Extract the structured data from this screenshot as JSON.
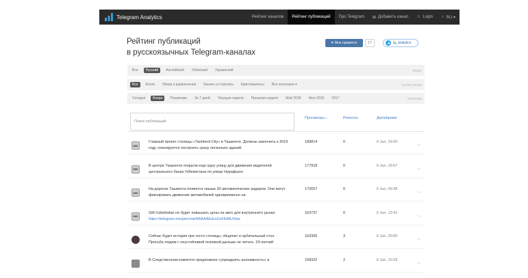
{
  "navbar": {
    "brand": "Telegram Analytics",
    "links": [
      {
        "label": "Рейтинг каналов",
        "icon": "",
        "active": false
      },
      {
        "label": "Рейтинг публикаций",
        "icon": "",
        "active": true
      },
      {
        "label": "Про Telegram",
        "icon": "",
        "active": false
      },
      {
        "label": "Добавить канал",
        "icon": "plus-square-icon",
        "active": false
      },
      {
        "label": "Login",
        "icon": "user-icon",
        "active": false
      },
      {
        "label": "RU ▾",
        "icon": "globe-icon",
        "active": false
      }
    ]
  },
  "header": {
    "title_line1": "Рейтинг публикаций",
    "title_line2": "в русскоязычных Telegram-каналах",
    "like_label": "Мне нравится",
    "like_count": "17",
    "tg_label": "tg_analytics"
  },
  "filters": {
    "language": {
      "items": [
        "Все",
        "Русский",
        "Английский",
        "Узбекский",
        "Украинский"
      ],
      "active_index": 1,
      "label": "ЯЗЫК"
    },
    "category": {
      "items": [
        "Все",
        "Блоги",
        "Юмор и развлечения",
        "Бизнес и стартапы",
        "Криптовалюты",
        "Все категории"
      ],
      "active_index": 0,
      "dropdown_index": 5,
      "label": "КАТЕГОРИИ"
    },
    "period": {
      "items": [
        "Сегодня",
        "Вчера",
        "Позавчера",
        "За 7 дней",
        "Текущая неделя",
        "Прошлая неделя",
        "Май 2018",
        "Июн 2018",
        "2017"
      ],
      "active_index": 1,
      "label": "ПЕРИОД"
    }
  },
  "search": {
    "placeholder": "Поиск публикаций"
  },
  "table": {
    "columns": {
      "views": "Просмотры ↓",
      "reposts": "Репосты",
      "date": "Дата/время"
    },
    "rows": [
      {
        "avatar": "MIX",
        "style": "av-mix",
        "text": "Главный проект столицы «Tashkent City» в Ташкенте. Должны закончить к 2019 году, планируется построить сразу несколько зданий.",
        "link": "",
        "views": "189814",
        "reposts": "0",
        "date": "6 Jun, 19:20"
      },
      {
        "avatar": "MIX",
        "style": "av-mix",
        "text": "В центре Ташкента открыли еще одну улицу для движения водителей центрального банка Узбекистана по улице Нурафшон",
        "link": "",
        "views": "177918",
        "reposts": "0",
        "date": "6 Jun, 15:57"
      },
      {
        "avatar": "MIX",
        "style": "av-mix",
        "text": "На дорогах Ташкента появятся свыше 30 автоматических радаров. Они могут фиксировать движение автомобилей одновременно на",
        "link": "",
        "views": "172657",
        "reposts": "0",
        "date": "6 Jun, 09:38"
      },
      {
        "avatar": "MIX",
        "style": "av-mix",
        "text": "GM Uzbekistan не будет повышать цены на авто для внутреннего рынка",
        "link": "https://telegram.me/joinchat/AAAAAEdcxGxFlbMUVbw",
        "views": "163737",
        "reposts": "0",
        "date": "6 Jun, 12:41"
      },
      {
        "avatar": "",
        "style": "av-dark",
        "text": "Сейчас будет история про гостя столицы, общепит и орбитальный стол. Просьба людям с неустойчивой психикой дальше не читать. 24-летний",
        "link": "",
        "views": "163306",
        "reposts": "3",
        "date": "6 Jun, 20:00"
      },
      {
        "avatar": "",
        "style": "av-gray",
        "text": "В Следственном комитете предложили «упразднить анонимность» в",
        "link": "",
        "views": "158322",
        "reposts": "2",
        "date": "6 Jun, 10:18"
      }
    ]
  },
  "colors": {
    "navbar_bg": "#2b2b2b",
    "accent_link": "#3a7bc8",
    "like_btn": "#4a76a8",
    "telegram": "#2fa3e1"
  }
}
